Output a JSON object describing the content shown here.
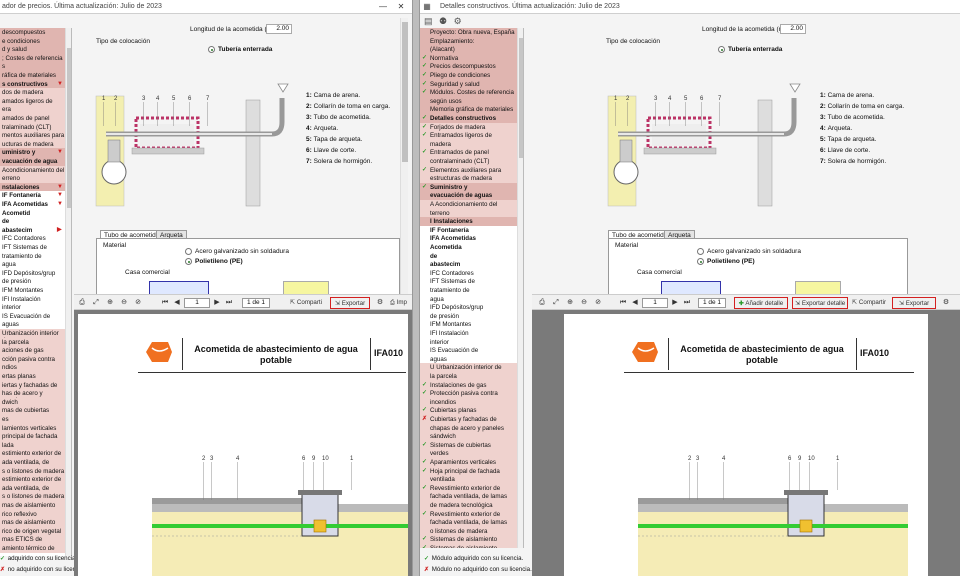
{
  "left": {
    "title": "ador de precios. Última actualización: Julio de 2023",
    "tree": [
      {
        "t": "descompuestos",
        "c": "hl"
      },
      {
        "t": "e condiciones",
        "c": "hl"
      },
      {
        "t": "d y salud",
        "c": "hl"
      },
      {
        "t": "; Costes de referencia",
        "c": "hl"
      },
      {
        "t": "s",
        "c": "hl"
      },
      {
        "t": "ráfica de materiales",
        "c": "hl"
      },
      {
        "t": "s constructivos",
        "c": "hl bold",
        "m": "▼"
      },
      {
        "t": "dos de madera",
        "c": "hl2"
      },
      {
        "t": "amados ligeros de",
        "c": "hl2"
      },
      {
        "t": "era",
        "c": "hl2"
      },
      {
        "t": "amados de panel",
        "c": "hl2"
      },
      {
        "t": "tralaminado (CLT)",
        "c": "hl2"
      },
      {
        "t": "mentos auxiliares para",
        "c": "hl2"
      },
      {
        "t": "ucturas de madera",
        "c": "hl2"
      },
      {
        "t": "uministro y",
        "c": "hl bold",
        "m": "▼"
      },
      {
        "t": "vacuación de agua",
        "c": "hl bold"
      },
      {
        "t": "Acondicionamiento del",
        "c": "hl2"
      },
      {
        "t": "erreno",
        "c": "hl2"
      },
      {
        "t": "nstalaciones",
        "c": "hl bold",
        "m": "▼"
      },
      {
        "t": "IF   Fontanería",
        "c": "bold",
        "m": "▼"
      },
      {
        "t": "IFA  Acometidas",
        "c": "bold",
        "m": "▼"
      },
      {
        "t": "Acometid",
        "c": "bold"
      },
      {
        "t": "de",
        "c": "bold"
      },
      {
        "t": "abastecim",
        "c": "bold",
        "m": "▶"
      },
      {
        "t": "IFC   Contadores",
        "c": ""
      },
      {
        "t": "IFT   Sistemas de",
        "c": ""
      },
      {
        "t": "tratamiento de",
        "c": ""
      },
      {
        "t": "agua",
        "c": ""
      },
      {
        "t": "IFD   Depósitos/grup",
        "c": ""
      },
      {
        "t": "de presión",
        "c": ""
      },
      {
        "t": "IFM   Montantes",
        "c": ""
      },
      {
        "t": "IFI    Instalación",
        "c": ""
      },
      {
        "t": "interior",
        "c": ""
      },
      {
        "t": "IS   Evacuación de",
        "c": ""
      },
      {
        "t": "aguas",
        "c": ""
      },
      {
        "t": "Urbanización interior de",
        "c": "hl2"
      },
      {
        "t": "la parcela",
        "c": "hl2"
      },
      {
        "t": "aciones de gas",
        "c": "hl2"
      },
      {
        "t": "cción pasiva contra",
        "c": "hl2"
      },
      {
        "t": "ndios",
        "c": "hl2"
      },
      {
        "t": "ertas planas",
        "c": "hl2"
      },
      {
        "t": "iertas y fachadas de",
        "c": "hl2"
      },
      {
        "t": "has de acero y paneles",
        "c": "hl2"
      },
      {
        "t": "dwich",
        "c": "hl2"
      },
      {
        "t": "mas de cubiertas",
        "c": "hl2"
      },
      {
        "t": "es",
        "c": "hl2"
      },
      {
        "t": "lamientos verticales",
        "c": "hl2"
      },
      {
        "t": "principal de fachada",
        "c": "hl2"
      },
      {
        "t": "lada",
        "c": "hl2"
      },
      {
        "t": "estimiento exterior de",
        "c": "hl2"
      },
      {
        "t": "ada ventilada, de",
        "c": "hl2"
      },
      {
        "t": "s o listones de madera",
        "c": "hl2"
      },
      {
        "t": "estimiento exterior de",
        "c": "hl2"
      },
      {
        "t": "ada ventilada, de",
        "c": "hl2"
      },
      {
        "t": "s o listones de madera",
        "c": "hl2"
      },
      {
        "t": "mas de aislamiento",
        "c": "hl2"
      },
      {
        "t": "rico reflexivo",
        "c": "hl2"
      },
      {
        "t": "mas de aislamiento",
        "c": "hl2"
      },
      {
        "t": "rico de origen vegetal",
        "c": "hl2"
      },
      {
        "t": "mas ETICS de",
        "c": "hl2"
      },
      {
        "t": "amiento térmico de",
        "c": "hl2"
      }
    ],
    "status1": "adquirido con su licencia.",
    "status2": "no adquirido con su licencia."
  },
  "right": {
    "title": "Detalles constructivos. Última actualización: Julio de 2023",
    "tree": [
      {
        "t": "Proyecto: Obra nueva, España",
        "c": "hl"
      },
      {
        "t": "Emplazamiento: Alacant/Alicante",
        "c": "hl"
      },
      {
        "t": "(Alacant)",
        "c": "hl"
      },
      {
        "t": "Normativa",
        "c": "hl",
        "m": "✓"
      },
      {
        "t": "Precios descompuestos",
        "c": "hl",
        "m": "✓"
      },
      {
        "t": "Pliego de condiciones",
        "c": "hl",
        "m": "✓"
      },
      {
        "t": "Seguridad y salud",
        "c": "hl",
        "m": "✓"
      },
      {
        "t": "Módulos. Costes de referencia",
        "c": "hl",
        "m": "✓"
      },
      {
        "t": "según usos",
        "c": "hl"
      },
      {
        "t": "Memoria gráfica de materiales",
        "c": "hl"
      },
      {
        "t": "Detalles constructivos",
        "c": "hl bold",
        "m": "✓"
      },
      {
        "t": "Forjados de madera",
        "c": "hl2",
        "m": "✓"
      },
      {
        "t": "Entramados ligeros de",
        "c": "hl2",
        "m": "✓"
      },
      {
        "t": "madera",
        "c": "hl2"
      },
      {
        "t": "Entramados de panel",
        "c": "hl2",
        "m": "✓"
      },
      {
        "t": "contralaminado (CLT)",
        "c": "hl2"
      },
      {
        "t": "Elementos auxiliares para",
        "c": "hl2",
        "m": "✓"
      },
      {
        "t": "estructuras de madera",
        "c": "hl2"
      },
      {
        "t": "Suministro y",
        "c": "hl bold",
        "m": "✓"
      },
      {
        "t": "evacuación de aguas",
        "c": "hl bold"
      },
      {
        "t": "A    Acondicionamiento del",
        "c": "hl2"
      },
      {
        "t": "terreno",
        "c": "hl2"
      },
      {
        "t": "I     Instalaciones",
        "c": "hl bold"
      },
      {
        "t": "IF   Fontanería",
        "c": "bold"
      },
      {
        "t": "IFA  Acometidas",
        "c": "bold"
      },
      {
        "t": "Acometida",
        "c": "bold"
      },
      {
        "t": "de",
        "c": "bold"
      },
      {
        "t": "abastecim",
        "c": "bold"
      },
      {
        "t": "IFC   Contadores",
        "c": ""
      },
      {
        "t": "IFT   Sistemas de",
        "c": ""
      },
      {
        "t": "tratamiento de",
        "c": ""
      },
      {
        "t": "agua",
        "c": ""
      },
      {
        "t": "IFD   Depósitos/grup",
        "c": ""
      },
      {
        "t": "de presión",
        "c": ""
      },
      {
        "t": "IFM   Montantes",
        "c": ""
      },
      {
        "t": "IFI    Instalación",
        "c": ""
      },
      {
        "t": "interior",
        "c": ""
      },
      {
        "t": "IS   Evacuación de",
        "c": ""
      },
      {
        "t": "aguas",
        "c": ""
      },
      {
        "t": "U    Urbanización interior de",
        "c": "hl2"
      },
      {
        "t": "la parcela",
        "c": "hl2"
      },
      {
        "t": "Instalaciones de gas",
        "c": "hl2",
        "m": "✓"
      },
      {
        "t": "Protección pasiva contra",
        "c": "hl2",
        "m": "✓"
      },
      {
        "t": "incendios",
        "c": "hl2"
      },
      {
        "t": "Cubiertas planas",
        "c": "hl2",
        "m": "✓"
      },
      {
        "t": "Cubiertas y fachadas de",
        "c": "hl2",
        "m": "✗"
      },
      {
        "t": "chapas de acero y paneles",
        "c": "hl2"
      },
      {
        "t": "sándwich",
        "c": "hl2"
      },
      {
        "t": "Sistemas de cubiertas",
        "c": "hl2",
        "m": "✓"
      },
      {
        "t": "verdes",
        "c": "hl2"
      },
      {
        "t": "Aparamientos verticales",
        "c": "hl2",
        "m": "✓"
      },
      {
        "t": "Hoja principal de fachada",
        "c": "hl2",
        "m": "✓"
      },
      {
        "t": "ventilada",
        "c": "hl2"
      },
      {
        "t": "Revestimiento exterior de",
        "c": "hl2",
        "m": "✓"
      },
      {
        "t": "fachada ventilada, de lamas",
        "c": "hl2"
      },
      {
        "t": "de madera tecnológica",
        "c": "hl2"
      },
      {
        "t": "Revestimiento exterior de",
        "c": "hl2",
        "m": "✓"
      },
      {
        "t": "fachada ventilada, de lamas",
        "c": "hl2"
      },
      {
        "t": "o listones de madera",
        "c": "hl2"
      },
      {
        "t": "Sistemas de aislamiento",
        "c": "hl2",
        "m": "✓"
      },
      {
        "t": "Sistemas de aislamiento",
        "c": "hl2",
        "m": "✓"
      }
    ],
    "status1": "Módulo adquirido con su licencia.",
    "status2": "Módulo no adquirido con su licencia.",
    "toolbar": {
      "add_detail": "Añadir detalle",
      "export_detail": "Exportar detalle",
      "share": "Compartir",
      "export": "Exportar"
    }
  },
  "common": {
    "length_label": "Longitud de la acometida (m)",
    "length_value": "2.00",
    "placement_label": "Tipo de colocación",
    "placement_value": "Tubería enterrada",
    "legend": [
      {
        "n": "1:",
        "t": "Cama de arena."
      },
      {
        "n": "2:",
        "t": "Collarín de toma en carga."
      },
      {
        "n": "3:",
        "t": "Tubo de acometida."
      },
      {
        "n": "4:",
        "t": "Arqueta."
      },
      {
        "n": "5:",
        "t": "Tapa de arqueta."
      },
      {
        "n": "6:",
        "t": "Llave de corte."
      },
      {
        "n": "7:",
        "t": "Solera de hormigón."
      }
    ],
    "tab1": "Tubo de acometida",
    "tab2": "Arqueta",
    "material_label": "Material",
    "mat1": "Acero galvanizado sin soldadura",
    "mat2": "Polietileno (PE)",
    "casa": "Casa comercial",
    "page_of": "1 de 1",
    "share_short": "Comparti",
    "export": "Exportar",
    "imp": "Imp",
    "doc_title": "Acometida de abastecimiento de agua potable",
    "doc_code": "IFA010",
    "callouts_a": [
      "2",
      "3",
      "4"
    ],
    "callouts_b": [
      "6",
      "9",
      "10",
      "1"
    ],
    "diag_nums": [
      "1",
      "2",
      "3",
      "4",
      "5",
      "6",
      "7"
    ]
  },
  "colors": {
    "tree_hl": "#e0b5b0",
    "accent_red": "#d42020",
    "pipe_green": "#33cc33",
    "logo_orange": "#f07020"
  }
}
